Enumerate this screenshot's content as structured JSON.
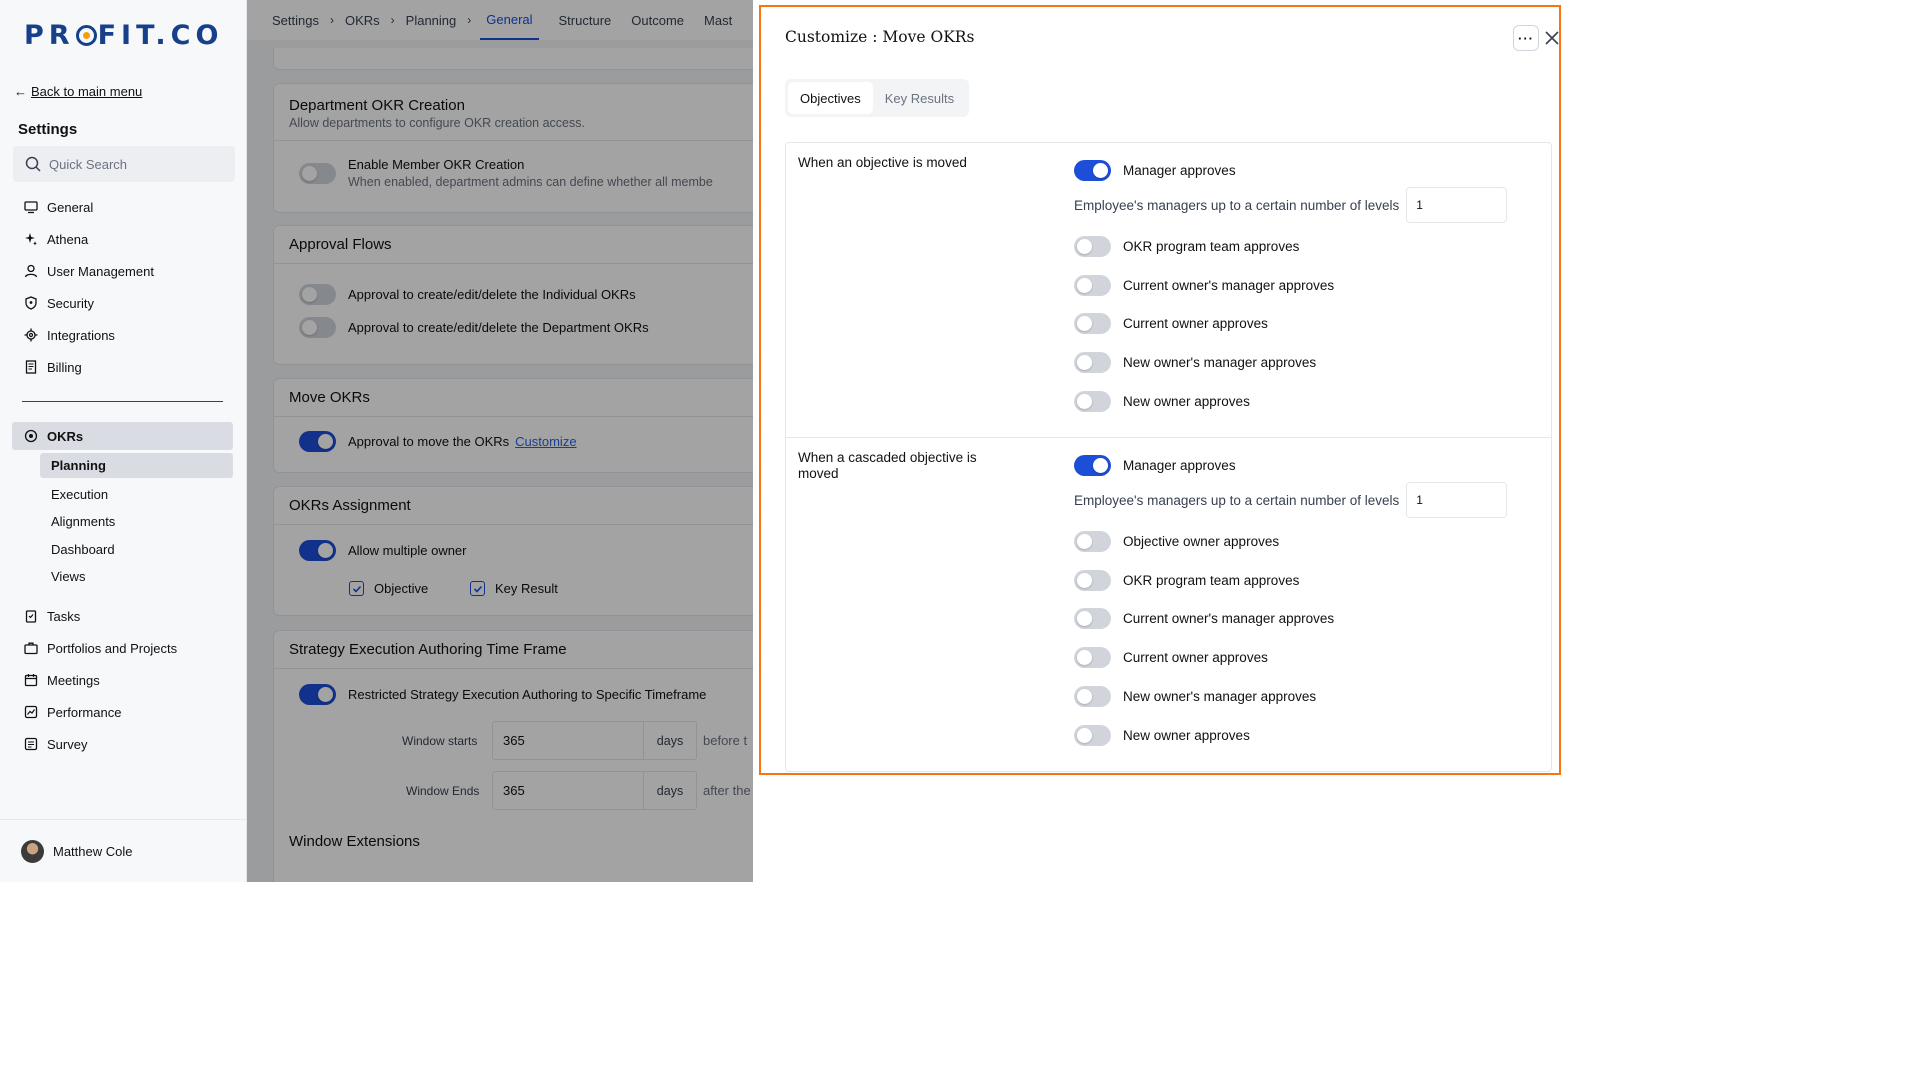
{
  "logo": "PROFIT.CO",
  "sidebar": {
    "back_label": "Back to main menu",
    "settings_title": "Settings",
    "search_placeholder": "Quick Search",
    "items": [
      {
        "label": "General",
        "icon": "monitor-icon"
      },
      {
        "label": "Athena",
        "icon": "sparkle-icon"
      },
      {
        "label": "User Management",
        "icon": "user-icon"
      },
      {
        "label": "Security",
        "icon": "shield-icon"
      },
      {
        "label": "Integrations",
        "icon": "gear-icon"
      },
      {
        "label": "Billing",
        "icon": "receipt-icon"
      }
    ],
    "okrs_label": "OKRs",
    "okrs_sub": [
      "Planning",
      "Execution",
      "Alignments",
      "Dashboard",
      "Views"
    ],
    "okrs_active": "Planning",
    "items2": [
      {
        "label": "Tasks",
        "icon": "clipboard-icon"
      },
      {
        "label": "Portfolios and Projects",
        "icon": "briefcase-icon"
      },
      {
        "label": "Meetings",
        "icon": "calendar-icon"
      },
      {
        "label": "Performance",
        "icon": "chart-icon"
      },
      {
        "label": "Survey",
        "icon": "survey-icon"
      }
    ],
    "user_name": "Matthew Cole"
  },
  "breadcrumb": {
    "items": [
      "Settings",
      "OKRs",
      "Planning"
    ],
    "tabs": [
      "General",
      "Structure",
      "Outcome",
      "Mast"
    ],
    "active_tab": "General"
  },
  "main": {
    "dept_title": "Department OKR Creation",
    "dept_sub": "Allow departments to configure OKR creation access.",
    "dept_toggle_label": "Enable Member OKR Creation",
    "dept_toggle_desc": "When enabled, department admins can define whether all membe",
    "approval_title": "Approval Flows",
    "approval_1": "Approval to create/edit/delete the Individual OKRs",
    "approval_2": "Approval to create/edit/delete the Department OKRs",
    "move_title": "Move OKRs",
    "move_label": "Approval to move the OKRs",
    "move_link": "Customize",
    "assign_title": "OKRs Assignment",
    "assign_label": "Allow multiple owner",
    "assign_objective": "Objective",
    "assign_key_result": "Key Result",
    "strategy_title": "Strategy Execution Authoring Time Frame",
    "strategy_label": "Restricted Strategy Execution Authoring to Specific Timeframe",
    "window_starts_label": "Window starts",
    "window_starts_value": "365",
    "window_starts_unit": "days",
    "window_starts_after": "before t",
    "window_ends_label": "Window Ends",
    "window_ends_value": "365",
    "window_ends_unit": "days",
    "window_ends_after": "after the",
    "extensions_title": "Window Extensions"
  },
  "drawer": {
    "title": "Customize : Move OKRs",
    "more_label": "···",
    "tabs": [
      "Objectives",
      "Key Results"
    ],
    "active_tab": "Objectives",
    "levels_label": "Employee's managers up to a certain number of levels",
    "section1": {
      "label": "When an objective is moved",
      "manager_approves": "Manager approves",
      "levels_value": "1",
      "options": [
        "OKR program team approves",
        "Current owner's manager approves",
        "Current owner approves",
        "New owner's manager approves",
        "New owner approves"
      ]
    },
    "section2": {
      "label": "When a cascaded objective is moved",
      "manager_approves": "Manager approves",
      "levels_value": "1",
      "options": [
        "Objective owner approves",
        "OKR program team approves",
        "Current owner's manager approves",
        "Current owner approves",
        "New owner's manager approves",
        "New owner approves"
      ]
    }
  },
  "colors": {
    "accent": "#1d4ed8",
    "highlight_border": "#f97316",
    "logo": "#17408b"
  }
}
